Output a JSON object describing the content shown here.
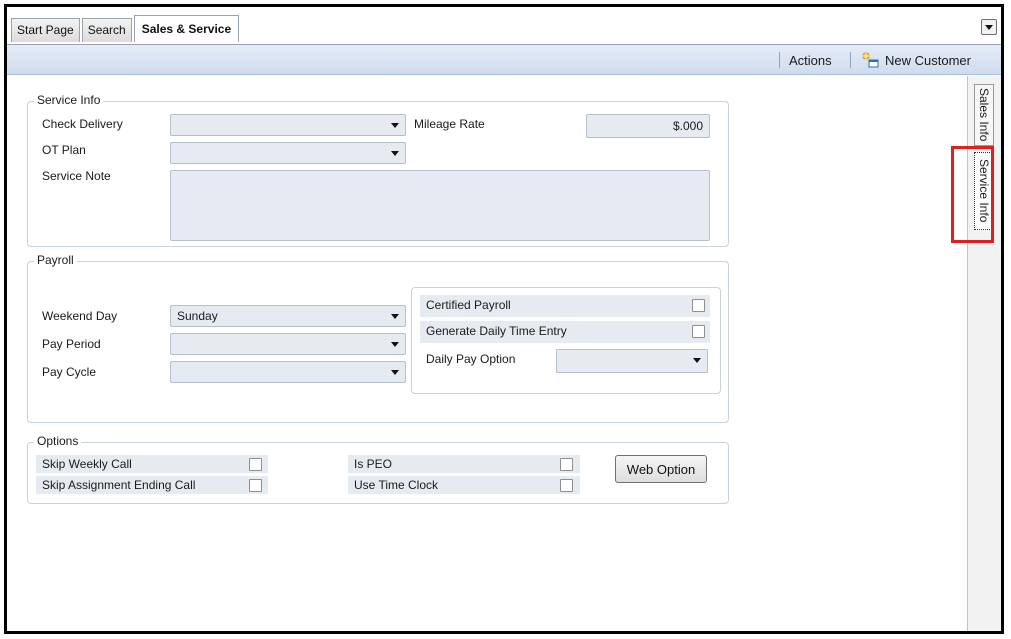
{
  "tabs": [
    {
      "label": "Start Page"
    },
    {
      "label": "Search"
    },
    {
      "label": "Sales & Service",
      "active": true
    }
  ],
  "toolbar": {
    "actions_label": "Actions",
    "new_customer_label": "New Customer"
  },
  "side_tabs": [
    {
      "label": "Sales Info"
    },
    {
      "label": "Service Info",
      "active": true
    }
  ],
  "service_info": {
    "title": "Service Info",
    "check_delivery_label": "Check Delivery",
    "check_delivery_value": "",
    "ot_plan_label": "OT Plan",
    "ot_plan_value": "",
    "service_note_label": "Service Note",
    "service_note_value": "",
    "mileage_rate_label": "Mileage Rate",
    "mileage_rate_value": "$.000"
  },
  "payroll": {
    "title": "Payroll",
    "weekend_day_label": "Weekend Day",
    "weekend_day_value": "Sunday",
    "pay_period_label": "Pay Period",
    "pay_period_value": "",
    "pay_cycle_label": "Pay Cycle",
    "pay_cycle_value": "",
    "certified_payroll_label": "Certified Payroll",
    "certified_payroll_checked": false,
    "generate_daily_label": "Generate Daily Time Entry",
    "generate_daily_checked": false,
    "daily_pay_option_label": "Daily Pay Option",
    "daily_pay_option_value": ""
  },
  "options": {
    "title": "Options",
    "skip_weekly_call_label": "Skip Weekly Call",
    "skip_assignment_label": "Skip Assignment Ending Call",
    "is_peo_label": "Is PEO",
    "use_time_clock_label": "Use Time Clock",
    "web_option_label": "Web Option"
  },
  "colors": {
    "toolbar_top": "#e4ecf7",
    "field_bg": "#e6ebf2",
    "highlight": "#e02020"
  }
}
